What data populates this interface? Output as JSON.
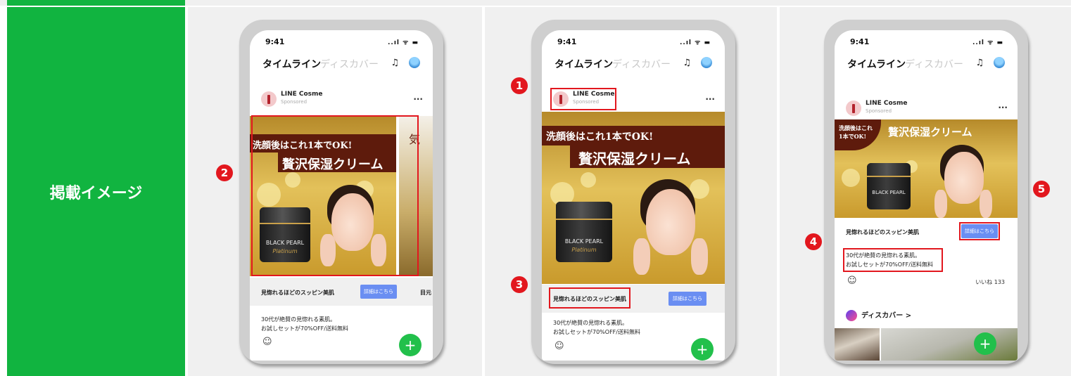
{
  "row_label": "掲載イメージ",
  "colors": {
    "line_green": "#11b440",
    "annotation_red": "#e2171e",
    "cta_blue": "#6a8ef2"
  },
  "phone": {
    "time": "9:41",
    "signal": "..ıl ᯤ ▬",
    "tab_active": "タイムライン",
    "tab_inactive": "ディスカバー",
    "bell_icon": "bell-icon",
    "account_name": "LINE Cosme",
    "account_sub": "Sponsored",
    "more": "...",
    "ad_line1": "洗顔後はこれ1本でOK!",
    "ad_line2": "贅沢保湿クリーム",
    "ad_line1_small_a": "洗顔後はこれ",
    "ad_line1_small_b": "1本でOK!",
    "jar_brand": "BLACK PEARL",
    "jar_script": "Platinum",
    "peek_text": "気",
    "headline": "見惚れるほどのスッピン美肌",
    "cta_label": "詳細はこちら",
    "peek_headline": "目元",
    "body_line1": "30代が絶賛の見惚れる素肌。",
    "body_line2": "お試しセットが70%OFF/送料無料",
    "smiley": "☺",
    "likes_full": "いいね 133",
    "likes_cut": "い   3",
    "fab_plus": "+",
    "discover_label": "ディスカバー >"
  },
  "markers": {
    "m1": "1",
    "m2": "2",
    "m3": "3",
    "m4": "4",
    "m5": "5"
  }
}
